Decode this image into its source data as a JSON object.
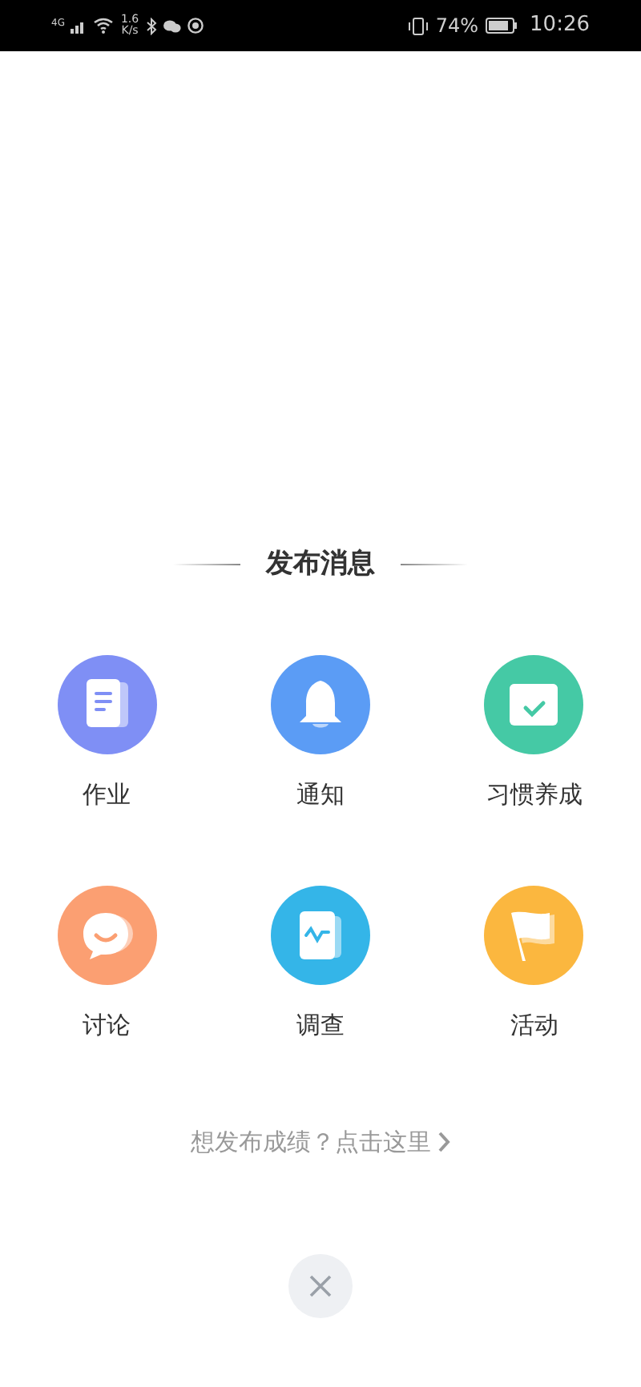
{
  "status_bar": {
    "network": "4G",
    "speed_value": "1.6",
    "speed_unit": "K/s",
    "battery": "74%",
    "time": "10:26"
  },
  "title": "发布消息",
  "actions": [
    {
      "label": "作业",
      "kind": "document",
      "color": "#7f8ff5"
    },
    {
      "label": "通知",
      "kind": "bell",
      "color": "#5b9cf5"
    },
    {
      "label": "习惯养成",
      "kind": "calendar",
      "color": "#45c9a5"
    },
    {
      "label": "讨论",
      "kind": "chat",
      "color": "#fb9f72"
    },
    {
      "label": "调查",
      "kind": "report",
      "color": "#34b5e8"
    },
    {
      "label": "活动",
      "kind": "flag",
      "color": "#fbb73f"
    }
  ],
  "link": "想发布成绩？点击这里"
}
